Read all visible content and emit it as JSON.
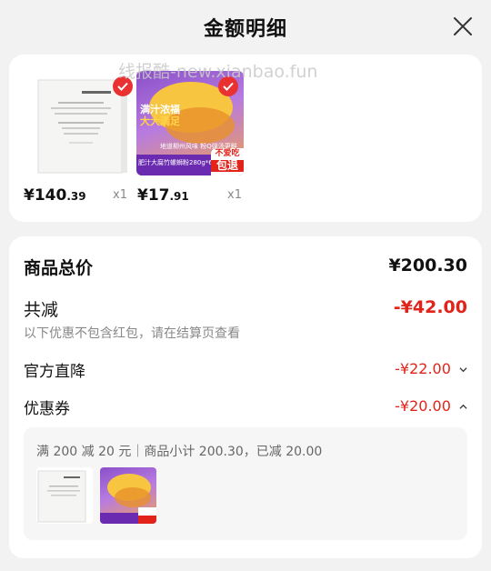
{
  "header": {
    "title": "金额明细"
  },
  "watermark": "线报酷-new.xianbao.fun",
  "products": [
    {
      "price_int": "¥140",
      "price_dec": ".39",
      "qty": "x1"
    },
    {
      "price_int": "¥17",
      "price_dec": ".91",
      "qty": "x1"
    }
  ],
  "product2_art": {
    "slogan1": "满汁浓福",
    "slogan2": "大大満足",
    "tag": "不爱吃",
    "tag2": "包退",
    "banner": "肥汁大腐竹螺蛳粉280g*6",
    "sub": "地道柳州风味 粉Q弹汤更鲜"
  },
  "summary": {
    "total_label": "商品总价",
    "total_value": "¥200.30",
    "discount_label": "共减",
    "discount_value": "-¥42.00",
    "discount_note": "以下优惠不包含红包，请在结算页查看",
    "official_label": "官方直降",
    "official_value": "-¥22.00",
    "coupon_label": "优惠券",
    "coupon_value": "-¥20.00",
    "coupon_detail": "满 200 减 20 元｜商品小计 200.30，已减 20.00"
  },
  "colors": {
    "accent": "#e2231a",
    "check": "#ea3131"
  }
}
